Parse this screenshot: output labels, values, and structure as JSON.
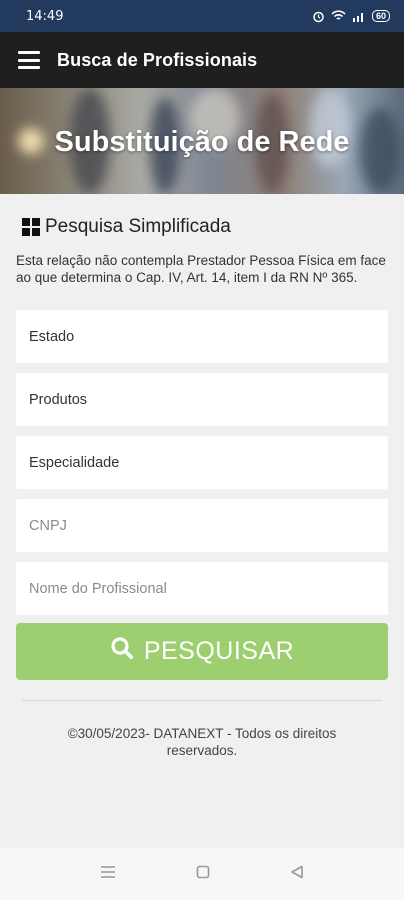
{
  "status": {
    "time": "14:49",
    "battery": "60"
  },
  "app_bar": {
    "title": "Busca de Profissionais"
  },
  "hero": {
    "title": "Substituição de Rede"
  },
  "section": {
    "title": "Pesquisa Simplificada"
  },
  "notice": "Esta relação não contempla Prestador Pessoa Física em face ao que determina o Cap. IV, Art. 14, item I da RN Nº 365.",
  "fields": {
    "estado": "Estado",
    "produtos": "Produtos",
    "especialidade": "Especialidade",
    "cnpj_placeholder": "CNPJ",
    "nome_placeholder": "Nome do Profissional"
  },
  "search_button": {
    "label": "PESQUISAR"
  },
  "footer": {
    "copyright": "©30/05/2023- DATANEXT - Todos os direitos reservados."
  },
  "colors": {
    "status_bar": "#223a5e",
    "app_bar": "#1f1f1f",
    "button": "#9dcf70"
  }
}
